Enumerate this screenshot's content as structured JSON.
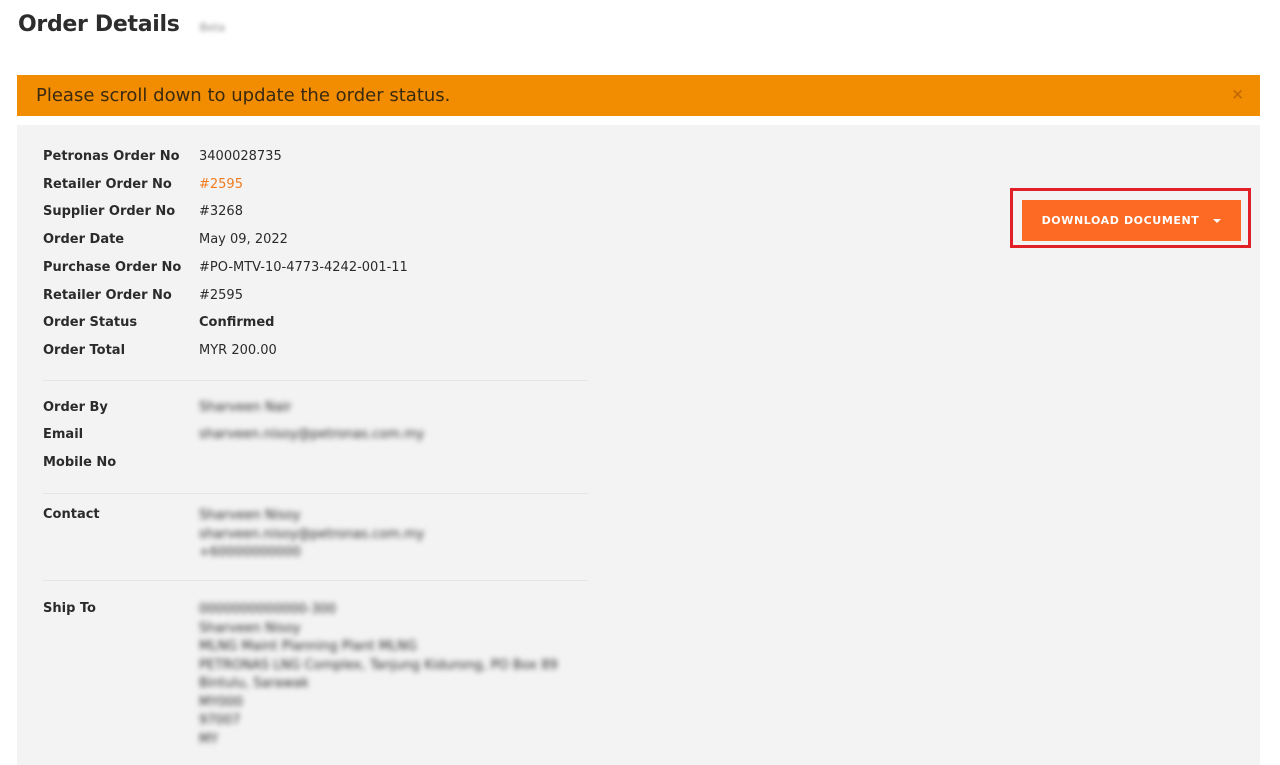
{
  "header": {
    "title": "Order Details",
    "subtitle": "Beta"
  },
  "alert": {
    "message": "Please scroll down to update the order status.",
    "close_icon": "×"
  },
  "download": {
    "label": "DOWNLOAD DOCUMENT"
  },
  "order": {
    "petronas_order_no": {
      "label": "Petronas Order No",
      "value": "3400028735"
    },
    "retailer_order_no_link": {
      "label": "Retailer Order No",
      "value": "#2595"
    },
    "supplier_order_no": {
      "label": "Supplier Order No",
      "value": "#3268"
    },
    "order_date": {
      "label": "Order Date",
      "value": "May 09, 2022"
    },
    "purchase_order_no": {
      "label": "Purchase Order No",
      "value": "#PO-MTV-10-4773-4242-001-11"
    },
    "retailer_order_no": {
      "label": "Retailer Order No",
      "value": "#2595"
    },
    "order_status": {
      "label": "Order Status",
      "value": "Confirmed"
    },
    "order_total": {
      "label": "Order Total",
      "value": "MYR 200.00"
    }
  },
  "customer": {
    "order_by": {
      "label": "Order By",
      "value": "Sharveen Nair"
    },
    "email": {
      "label": "Email",
      "value": "sharveen.nisoy@petronas.com.my"
    },
    "mobile": {
      "label": "Mobile No",
      "value": ""
    }
  },
  "contact": {
    "label": "Contact",
    "line1": "Sharveen Nisoy",
    "line2": "sharveen.nisoy@petronas.com.my",
    "line3": "+60000000000"
  },
  "ship_to": {
    "label": "Ship To",
    "line1": "0000000000000-300",
    "line2": "Sharveen Nisoy",
    "line3": "MLNG Maint Planning Plant MLNG",
    "line4": "PETRONAS LNG Complex, Tanjung Kidurong, PO Box 89",
    "line5": "Bintulu, Sarawak",
    "line6": "MY000",
    "line7": "97007",
    "line8": "MY"
  }
}
